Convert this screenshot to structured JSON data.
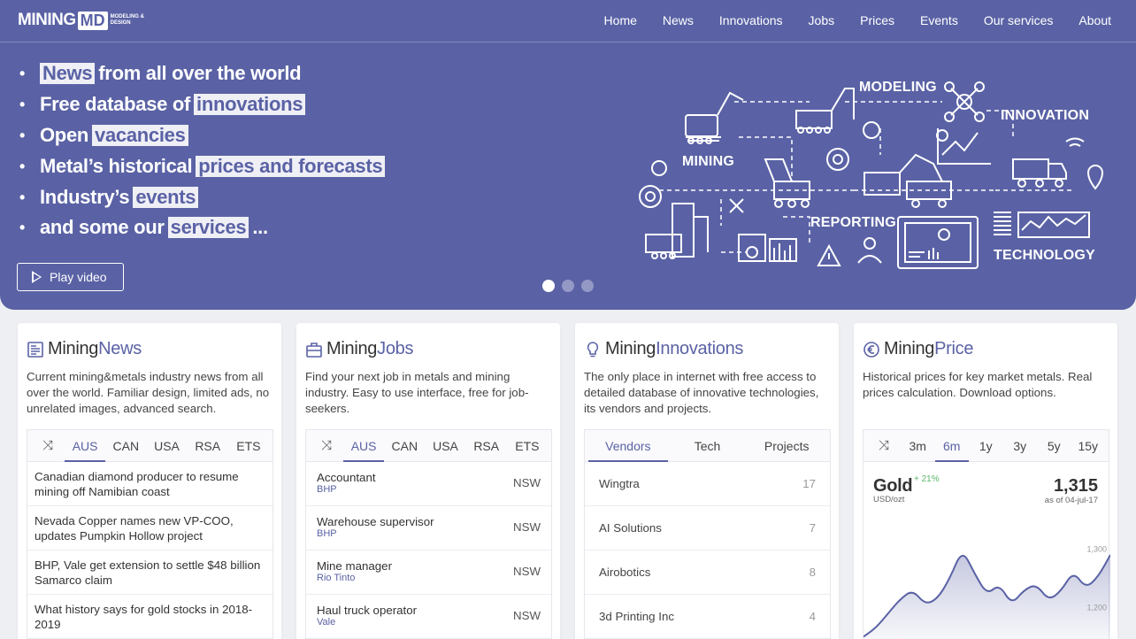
{
  "logo": {
    "main": "MINING",
    "badge": "MD",
    "sub": "MODELING & DESIGN"
  },
  "nav": [
    "Home",
    "News",
    "Innovations",
    "Jobs",
    "Prices",
    "Events",
    "Our services",
    "About"
  ],
  "hero": {
    "bullets": [
      {
        "pre": "",
        "hl": "News",
        "post": "from all over the world"
      },
      {
        "pre": "Free database of",
        "hl": "innovations",
        "post": ""
      },
      {
        "pre": "Open",
        "hl": "vacancies",
        "post": ""
      },
      {
        "pre": "Metal’s historical",
        "hl": "prices and forecasts",
        "post": ""
      },
      {
        "pre": "Industry’s",
        "hl": "events",
        "post": ""
      },
      {
        "pre": "and some our",
        "hl": "services",
        "post": "..."
      }
    ],
    "play_label": "Play video",
    "slides": 3,
    "active_slide": 0,
    "illustration_labels": {
      "modeling": "MODELING",
      "innovation": "INNOVATION",
      "mining": "MINING",
      "reporting": "REPORTING",
      "technology": "TECHNOLOGY"
    }
  },
  "news": {
    "title_a": "Mining",
    "title_b": "News",
    "desc": "Current mining&metals industry news from all over the world. Familiar design, limited ads, no unrelated images, advanced search.",
    "tabs": [
      "AUS",
      "CAN",
      "USA",
      "RSA",
      "ETS"
    ],
    "active_tab": "AUS",
    "items": [
      "Canadian diamond producer to resume mining off Namibian coast",
      "Nevada Copper names new VP-COO, updates Pumpkin Hollow project",
      "BHP, Vale get extension to settle $48 billion Samarco claim",
      "What history says for gold stocks in 2018-2019"
    ]
  },
  "jobs": {
    "title_a": "Mining",
    "title_b": "Jobs",
    "desc": "Find your next job in metals and mining industry. Easy to use interface, free for job-seekers.",
    "tabs": [
      "AUS",
      "CAN",
      "USA",
      "RSA",
      "ETS"
    ],
    "active_tab": "AUS",
    "items": [
      {
        "title": "Accountant",
        "company": "BHP",
        "region": "NSW"
      },
      {
        "title": "Warehouse supervisor",
        "company": "BHP",
        "region": "NSW"
      },
      {
        "title": "Mine manager",
        "company": "Rio Tinto",
        "region": "NSW"
      },
      {
        "title": "Haul truck operator",
        "company": "Vale",
        "region": "NSW"
      }
    ]
  },
  "innovations": {
    "title_a": "Mining",
    "title_b": "Innovations",
    "desc": "The only place in internet with free access to detailed database of innovative technologies, its vendors and projects.",
    "tabs": [
      "Vendors",
      "Tech",
      "Projects"
    ],
    "active_tab": "Vendors",
    "items": [
      {
        "name": "Wingtra",
        "count": "17"
      },
      {
        "name": "AI Solutions",
        "count": "7"
      },
      {
        "name": "Airobotics",
        "count": "8"
      },
      {
        "name": "3d Printing Inc",
        "count": "4"
      }
    ]
  },
  "price": {
    "title_a": "Mining",
    "title_b": "Price",
    "desc": "Historical prices for key market metals. Real prices calculation. Download options.",
    "tabs": [
      "3m",
      "6m",
      "1y",
      "3y",
      "5y",
      "15y"
    ],
    "active_tab": "6m",
    "metal": "Gold",
    "change": "+ 21%",
    "unit": "USD/ozt",
    "value": "1,315",
    "date": "as of 04-jul-17",
    "chart_data": {
      "type": "area",
      "y_ticks": [
        "1,300",
        "1,200"
      ],
      "values": [
        1150,
        1165,
        1190,
        1215,
        1230,
        1205,
        1215,
        1250,
        1300,
        1258,
        1222,
        1240,
        1205,
        1230,
        1240,
        1212,
        1228,
        1262,
        1233,
        1252,
        1290
      ],
      "ylim": [
        1140,
        1340
      ],
      "color": "#5a62a5"
    }
  },
  "colors": {
    "brand": "#5a62a5",
    "positive": "#5ab86a"
  }
}
